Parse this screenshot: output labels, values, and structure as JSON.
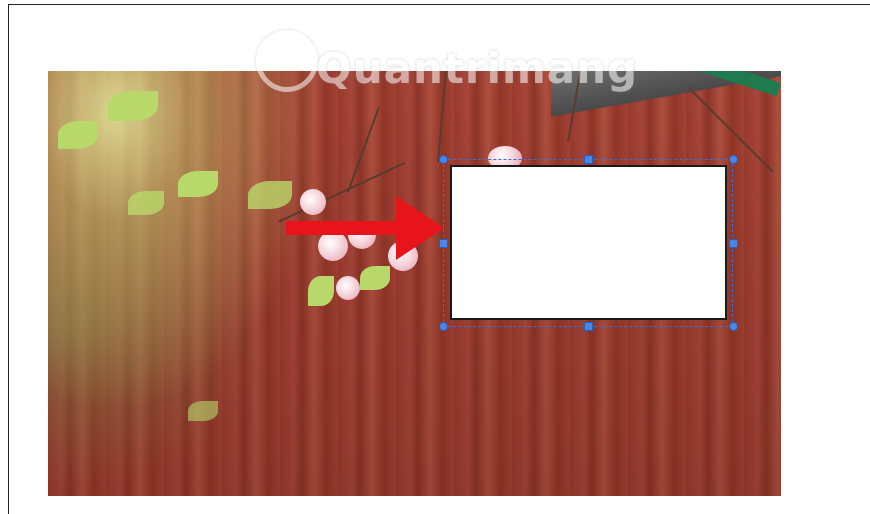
{
  "watermark": {
    "text": "Quantrimang"
  },
  "colors": {
    "arrow": "#e8141b",
    "selection": "#3b6fd6",
    "handle": "#4a86e8",
    "wall": "#9d3f31"
  },
  "icons": {
    "watermark_logo": "lightbulb-icon",
    "arrow": "right-arrow-shape"
  }
}
